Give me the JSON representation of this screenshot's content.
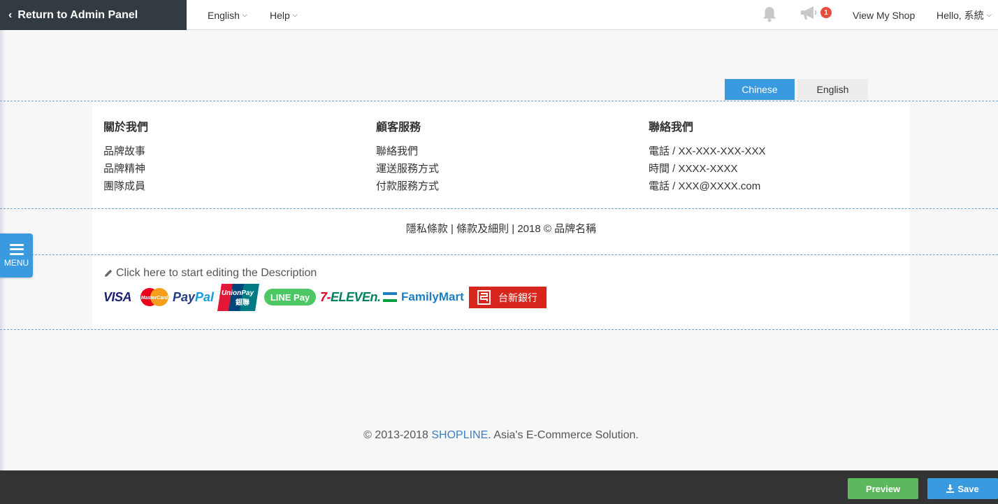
{
  "topbar": {
    "return_label": "Return to Admin Panel",
    "language_label": "English",
    "help_label": "Help",
    "notification_badge": "1",
    "view_shop_label": "View My Shop",
    "greeting_label": "Hello, 系統"
  },
  "lang_tabs": [
    {
      "label": "Chinese",
      "active": true
    },
    {
      "label": "English",
      "active": false
    }
  ],
  "footer": {
    "columns": [
      {
        "title": "關於我們",
        "items": [
          "品牌故事",
          "品牌精神",
          "團隊成員"
        ]
      },
      {
        "title": "顧客服務",
        "items": [
          "聯絡我們",
          "運送服務方式",
          "付款服務方式"
        ]
      },
      {
        "title": "聯絡我們",
        "items": [
          "電話 / XX-XXX-XXX-XXX",
          "時間 / XXXX-XXXX",
          "電話 / XXX@XXXX.com"
        ]
      }
    ],
    "legal_text": "隱私條款 | 條款及細則 | 2018 © 品牌名稱",
    "edit_description": "Click here to start editing the Description",
    "payment_logos": {
      "visa": "VISA",
      "mastercard": "MasterCard",
      "paypal_pay": "Pay",
      "paypal_pal": "Pal",
      "unionpay": "UnionPay",
      "unionpay_cn": "銀聯",
      "linepay": "LINE Pay",
      "seven_num": "7-",
      "seven_text": "ELEVEn.",
      "familymart": "FamilyMart",
      "taishin": "台新銀行"
    }
  },
  "copyright": {
    "prefix": "© 2013-2018 ",
    "brand": "SHOPLINE",
    "suffix": ". Asia's E-Commerce Solution."
  },
  "menu_button": {
    "label": "MENU"
  },
  "bottombar": {
    "preview_label": "Preview",
    "save_label": "Save"
  },
  "colors": {
    "accent": "#3a9ae0",
    "preview_green": "#5cb85c",
    "topbar_dark": "#333b42",
    "bottombar_dark": "#333333",
    "badge_red": "#e74c3c"
  }
}
